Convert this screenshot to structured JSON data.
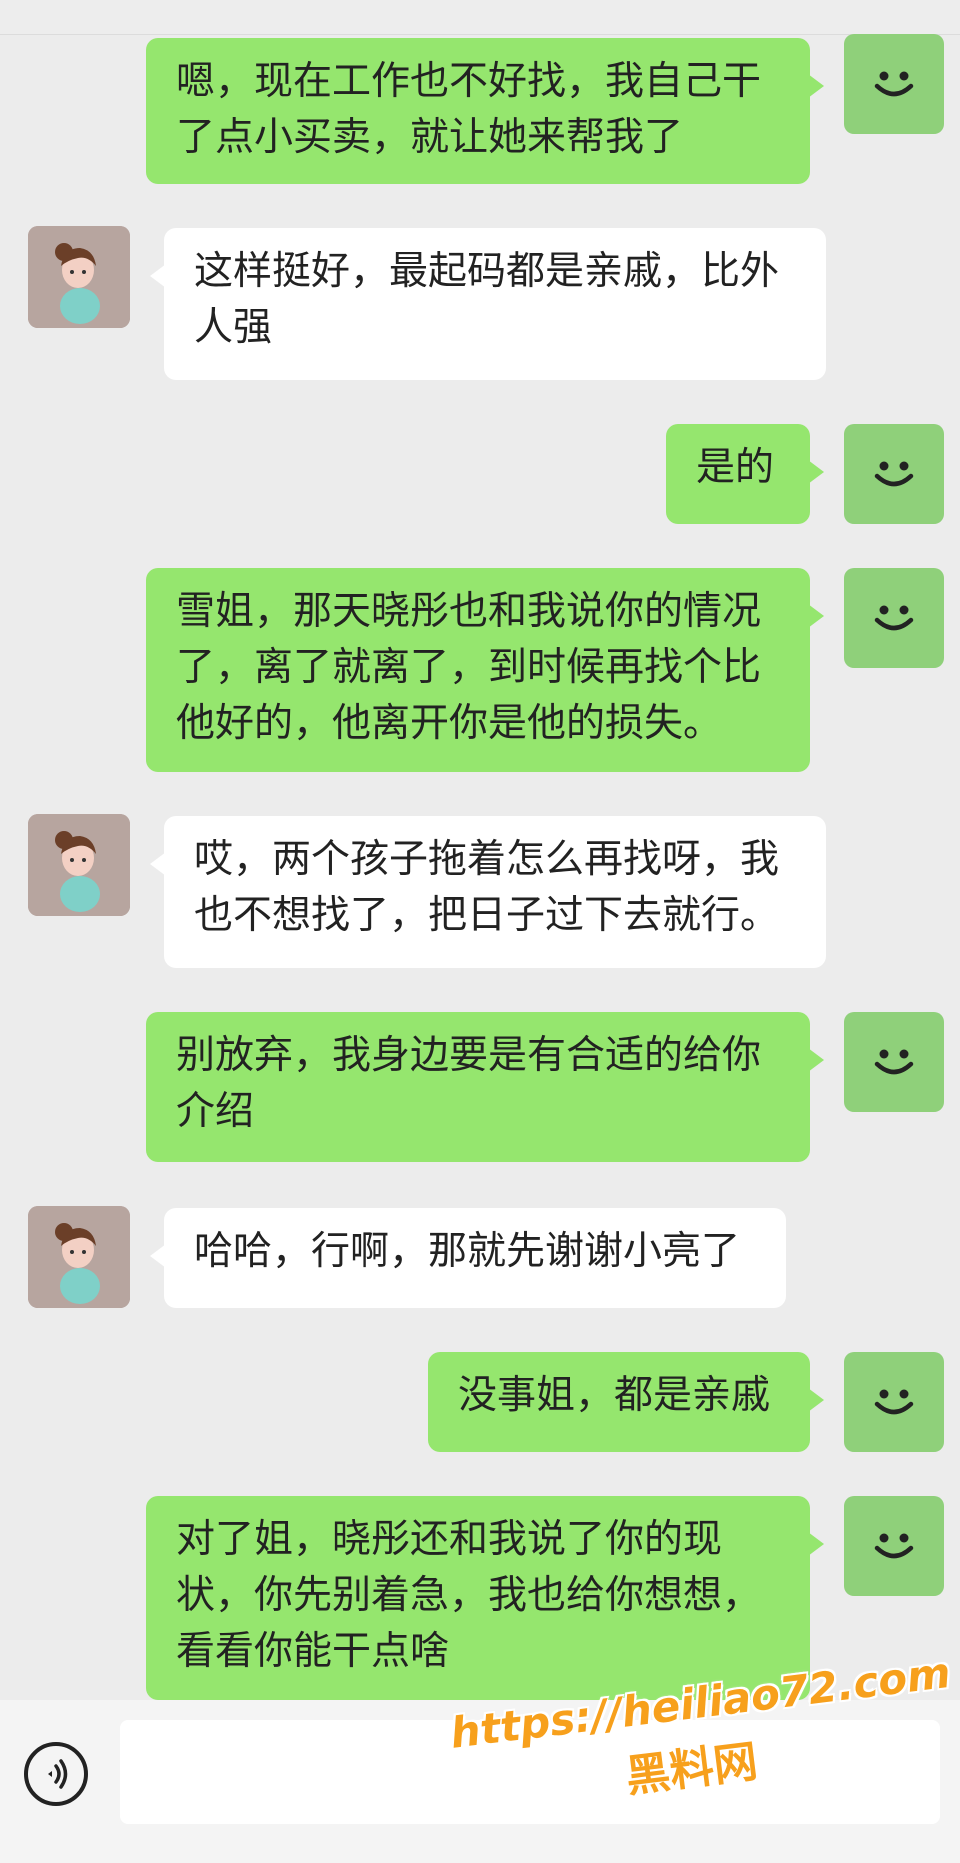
{
  "messages": [
    {
      "sender": "me",
      "text": "嗯，现在工作也不好找，我自己干\n了点小买卖，就让她来帮我了"
    },
    {
      "sender": "them",
      "text": "这样挺好，最起码都是亲戚，比外\n人强"
    },
    {
      "sender": "me",
      "text": "是的"
    },
    {
      "sender": "me",
      "text": "雪姐，那天晓彤也和我说你的情况\n了，离了就离了，到时候再找个比\n他好的，他离开你是他的损失。"
    },
    {
      "sender": "them",
      "text": "哎，两个孩子拖着怎么再找呀，我\n也不想找了，把日子过下去就行。"
    },
    {
      "sender": "me",
      "text": "别放弃，我身边要是有合适的给你\n介绍"
    },
    {
      "sender": "them",
      "text": "哈哈，行啊，那就先谢谢小亮了"
    },
    {
      "sender": "me",
      "text": "没事姐，都是亲戚"
    },
    {
      "sender": "me",
      "text": "对了姐，晓彤还和我说了你的现\n状，你先别着急，我也给你想想，\n看看你能干点啥"
    }
  ],
  "icons": {
    "my_avatar": "smiley-face-icon",
    "their_avatar": "cartoon-girl-avatar-icon",
    "voice": "voice-input-icon"
  },
  "watermark": {
    "url": "https://heiliao72.com",
    "name": "黑料网"
  },
  "colors": {
    "my_bubble": "#95e66e",
    "their_bubble": "#ffffff",
    "background": "#ececec",
    "watermark": "#f7a01c"
  }
}
